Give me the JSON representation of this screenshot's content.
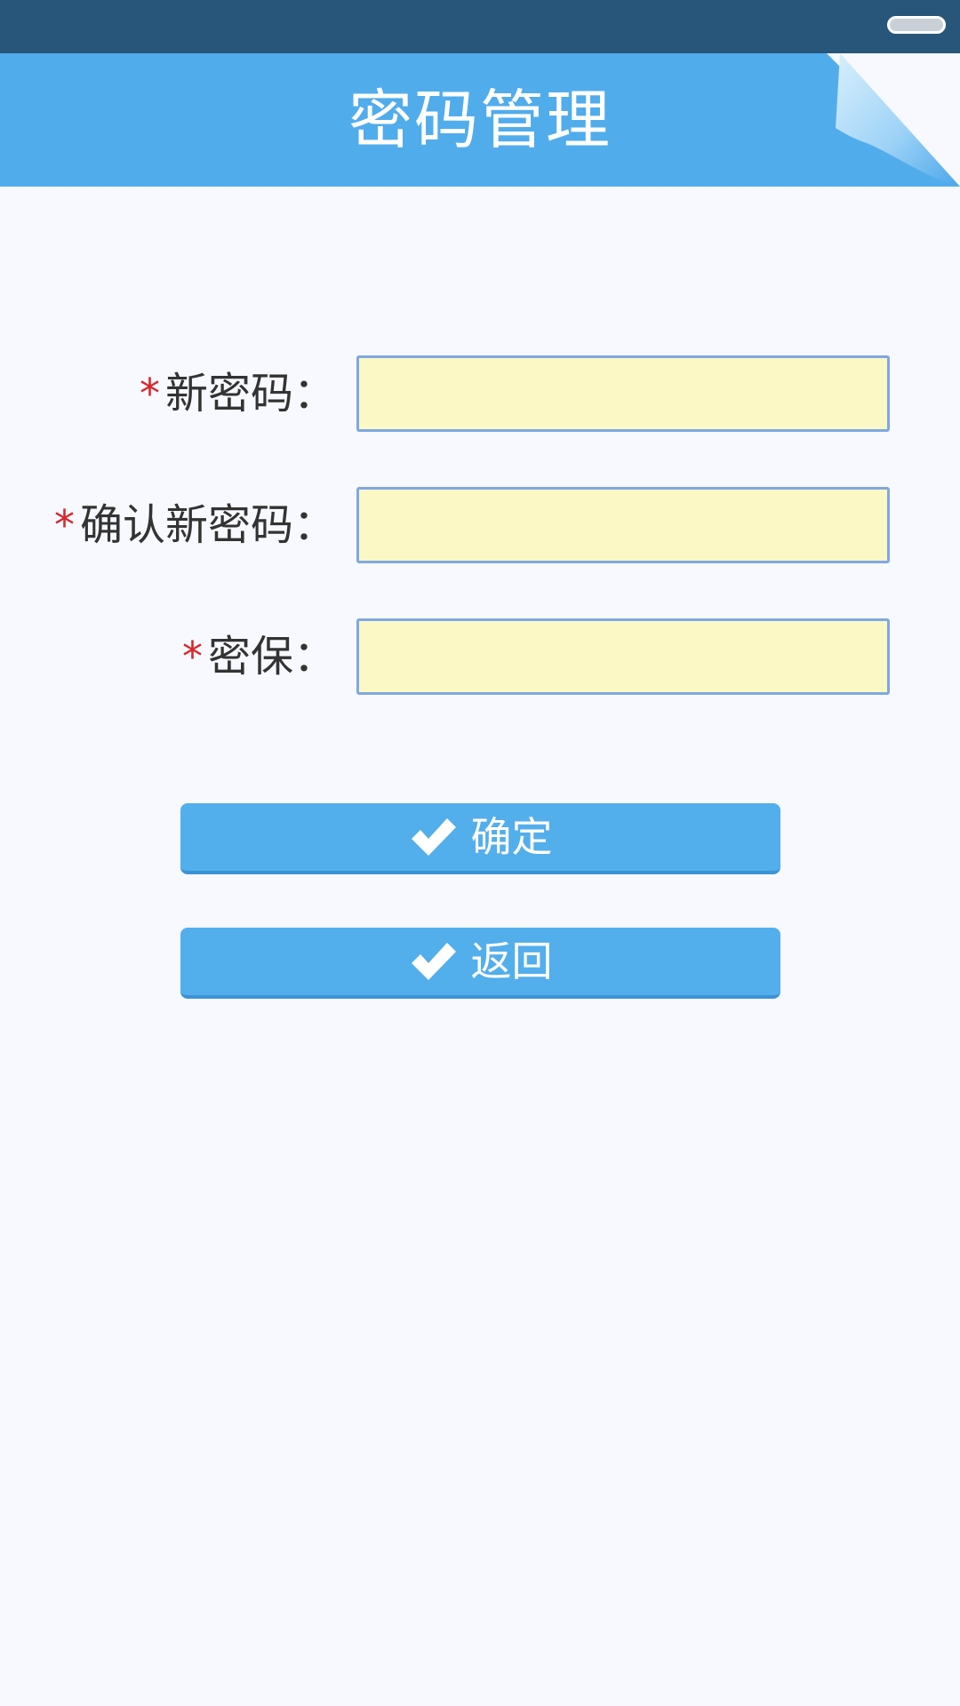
{
  "header": {
    "title": "密码管理"
  },
  "form": {
    "fields": [
      {
        "label": "新密码：",
        "required_mark": "*",
        "value": "",
        "placeholder": ""
      },
      {
        "label": "确认新密码：",
        "required_mark": "*",
        "value": "",
        "placeholder": ""
      },
      {
        "label": "密保：",
        "required_mark": "*",
        "value": "",
        "placeholder": ""
      }
    ]
  },
  "buttons": {
    "confirm_label": "确定",
    "back_label": "返回"
  },
  "icons": {
    "confirm_button_icon": "check-icon",
    "back_button_icon": "check-icon"
  },
  "colors": {
    "status_bar": "#27567a",
    "header": "#51acec",
    "button": "#53aeec",
    "input_background": "#fbf8c5",
    "input_border": "#7fa8e2",
    "required_mark": "#d9262a",
    "label_text": "#333333",
    "page_background": "#f7f9fe"
  }
}
